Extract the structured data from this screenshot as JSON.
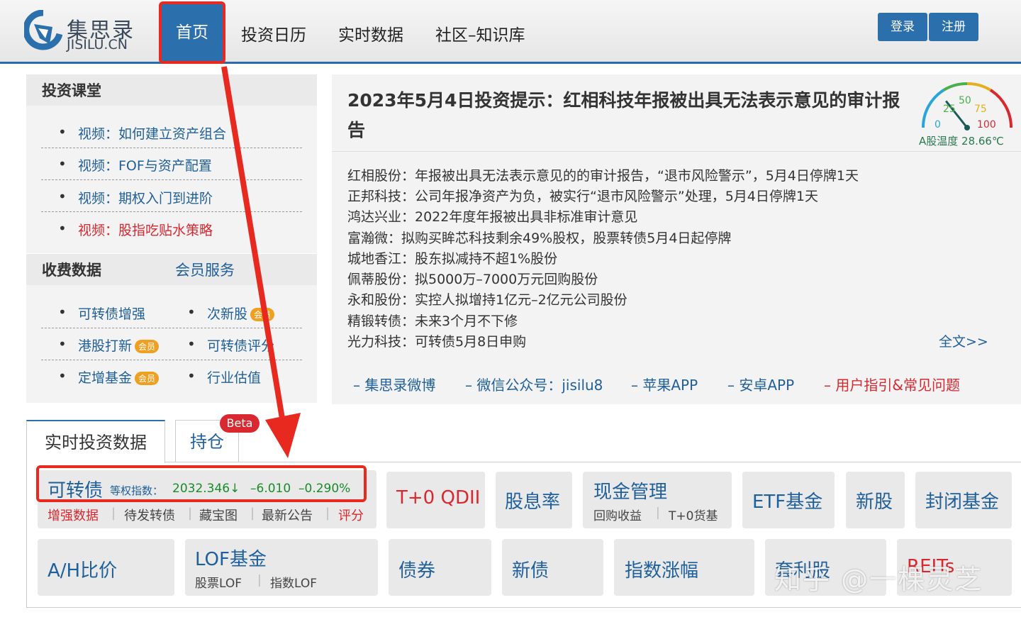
{
  "header": {
    "logo_cn": "集思录",
    "logo_en": "JISILU.CN",
    "nav": [
      "首页",
      "投资日历",
      "实时数据",
      "社区–知识库"
    ],
    "login": "登录",
    "register": "注册"
  },
  "course": {
    "title": "投资课堂",
    "items": [
      "视频：如何建立资产组合",
      "视频：FOF与资产配置",
      "视频：期权入门到进阶",
      "视频：股指吃贴水策略"
    ]
  },
  "paid": {
    "title": "收费数据",
    "service": "会员服务",
    "badge": "会员",
    "items": [
      "可转债增强",
      "次新股",
      "港股打新",
      "可转债评分",
      "定增基金",
      "行业估值"
    ]
  },
  "news": {
    "title": "2023年5月4日投资提示：红相科技年报被出具无法表示意见的审计报告",
    "lines": [
      "红相股份：年报被出具无法表示意见的的审计报告，“退市风险警示”，5月4日停牌1天",
      "正邦科技：公司年报净资产为负，被实行“退市风险警示”处理，5月4日停牌1天",
      "鸿达兴业：2022年度年报被出具非标准审计意见",
      "富瀚微：拟购买眸芯科技剩余49%股权，股票转债5月4日起停牌",
      "城地香江：股东拟减持不超1%股份",
      "佩蒂股份：拟5000万–7000万元回购股份",
      "永和股份：实控人拟增持1亿元–2亿元公司股份",
      "精锻转债：未来3个月不下修",
      "光力科技：可转债5月8日申购"
    ],
    "more": "全文>>",
    "links": [
      "– 集思录微博",
      "– 微信公众号：jisilu8",
      "– 苹果APP",
      "– 安卓APP",
      "– 用户指引&常见问题"
    ]
  },
  "gauge": {
    "ticks": [
      "0",
      "25",
      "50",
      "75",
      "100"
    ],
    "label": "A股温度 28.66℃",
    "value": 28.66
  },
  "tabs": {
    "realtime": "实时投资数据",
    "holdings": "持仓",
    "beta": "Beta"
  },
  "cb": {
    "title": "可转债",
    "index_label": "等权指数：",
    "index_value": "2032.346",
    "arrow": "↓",
    "change": "–6.010",
    "pct": "–0.290%",
    "subs": [
      "增强数据",
      "待发转债",
      "藏宝图",
      "最新公告",
      "评分"
    ]
  },
  "tiles": {
    "qdii": "T+0 QDII",
    "dividend": "股息率",
    "cash": "现金管理",
    "cash_subs": [
      "回购收益",
      "T+0货基"
    ],
    "etf": "ETF基金",
    "ipo": "新股",
    "closed": "封闭基金",
    "ah": "A/H比价",
    "lof": "LOF基金",
    "lof_subs": [
      "股票LOF",
      "指数LOF"
    ],
    "bond": "债券",
    "newbond": "新债",
    "index": "指数涨幅",
    "arb": "套利股",
    "reits": "REITs"
  },
  "watermark": "知乎 @一棵灵芝"
}
